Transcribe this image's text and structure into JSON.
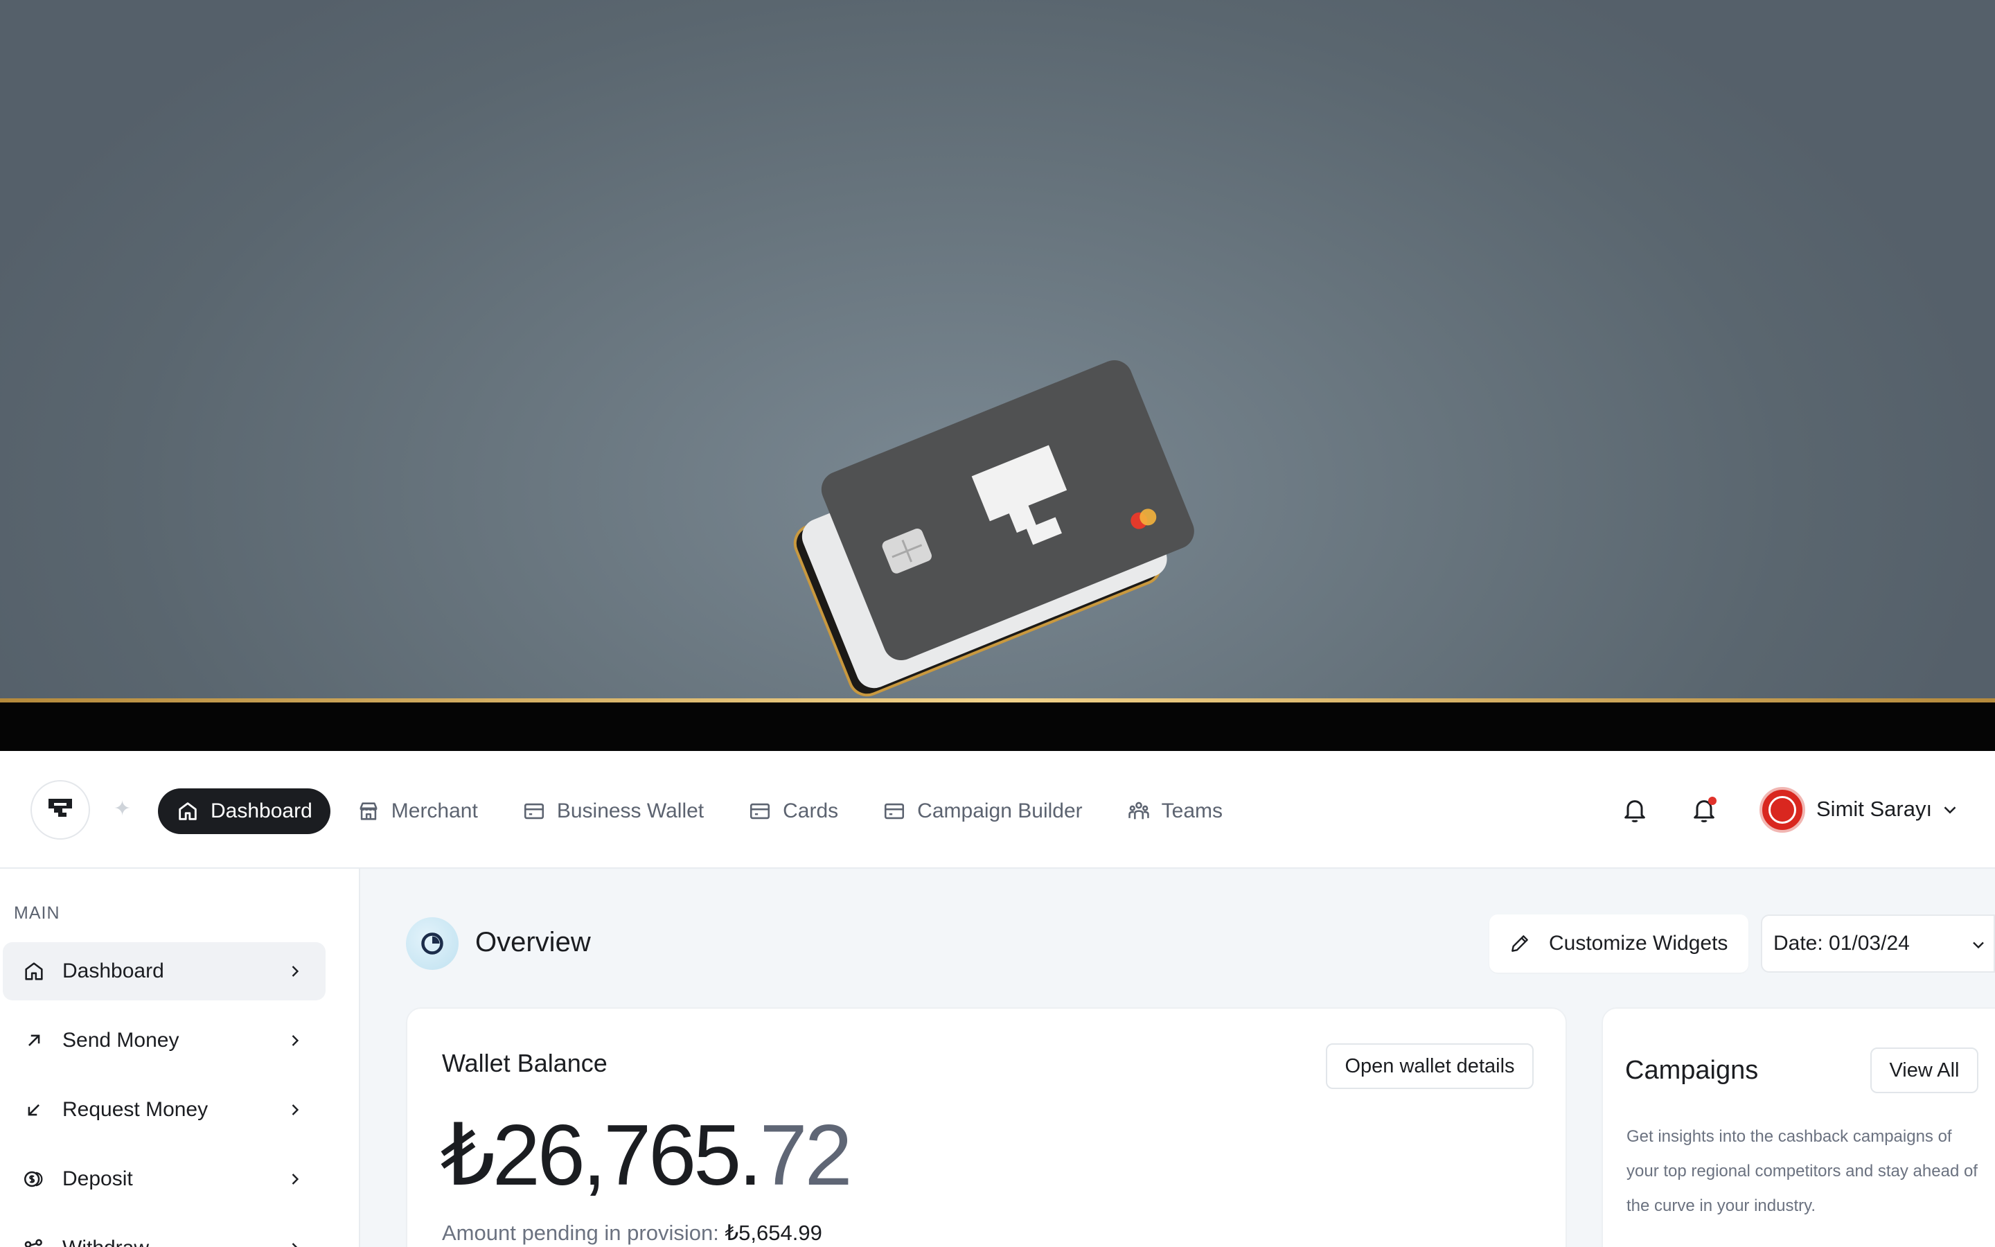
{
  "nav": {
    "items": [
      {
        "label": "Dashboard",
        "icon": "home-icon",
        "active": true
      },
      {
        "label": "Merchant",
        "icon": "store-icon",
        "active": false
      },
      {
        "label": "Business Wallet",
        "icon": "wallet-icon",
        "active": false
      },
      {
        "label": "Cards",
        "icon": "card-icon",
        "active": false
      },
      {
        "label": "Campaign Builder",
        "icon": "campaign-icon",
        "active": false
      },
      {
        "label": "Teams",
        "icon": "team-icon",
        "active": false
      }
    ]
  },
  "user": {
    "name": "Simit Sarayı"
  },
  "sidebar": {
    "section": "MAIN",
    "items": [
      {
        "label": "Dashboard",
        "icon": "home-icon",
        "active": true
      },
      {
        "label": "Send Money",
        "icon": "arrow-up-right-icon",
        "active": false
      },
      {
        "label": "Request Money",
        "icon": "arrow-down-left-icon",
        "active": false
      },
      {
        "label": "Deposit",
        "icon": "coins-icon",
        "active": false
      },
      {
        "label": "Withdraw",
        "icon": "withdraw-icon",
        "active": false
      }
    ]
  },
  "overview": {
    "title": "Overview",
    "customize_label": "Customize Widgets",
    "date_label": "Date: 01/03/24"
  },
  "wallet": {
    "title": "Wallet Balance",
    "open_label": "Open wallet details",
    "amount_main": "₺26,765.",
    "amount_cents": "72",
    "pending_label": "Amount pending in provision:",
    "pending_value": "₺5,654.99"
  },
  "campaigns": {
    "title": "Campaigns",
    "view_all_label": "View All",
    "description": "Get insights into the cashback campaigns of your top regional competitors and stay ahead of the curve in your industry."
  },
  "colors": {
    "accent_dark": "#1b1d21",
    "notification": "#e0322b",
    "avatar_red": "#d9271f"
  }
}
